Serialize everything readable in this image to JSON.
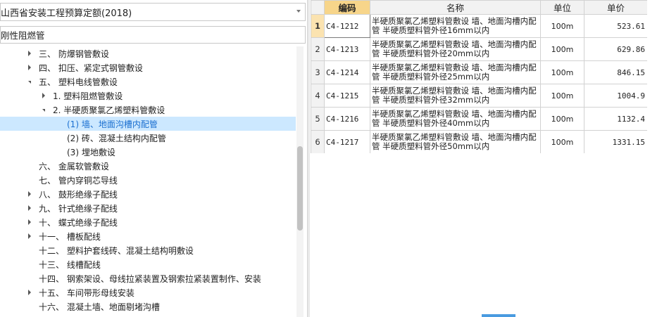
{
  "left": {
    "quota_select": "山西省安装工程预算定额(2018)",
    "search_value": "刚性阻燃管",
    "tree": [
      {
        "label": "三、 防爆钢管敷设",
        "level": 1,
        "state": "collapsed"
      },
      {
        "label": "四、 扣压、紧定式钢管敷设",
        "level": 1,
        "state": "collapsed"
      },
      {
        "label": "五、 塑料电线管敷设",
        "level": 1,
        "state": "expanded"
      },
      {
        "label": "1. 塑料阻燃管敷设",
        "level": 2,
        "state": "collapsed"
      },
      {
        "label": "2. 半硬质聚氯乙烯塑料管敷设",
        "level": 2,
        "state": "expanded"
      },
      {
        "label": "(1) 墙、地面沟槽内配管",
        "level": 3,
        "state": "leaf",
        "selected": true
      },
      {
        "label": "(2) 砖、混凝土结构内配管",
        "level": 3,
        "state": "leaf"
      },
      {
        "label": "(3) 埋地敷设",
        "level": 3,
        "state": "leaf"
      },
      {
        "label": "六、 金属软管敷设",
        "level": 1,
        "state": "leaf"
      },
      {
        "label": "七、 管内穿铜芯导线",
        "level": 1,
        "state": "leaf"
      },
      {
        "label": "八、 鼓形绝缘子配线",
        "level": 1,
        "state": "collapsed"
      },
      {
        "label": "九、 针式绝缘子配线",
        "level": 1,
        "state": "collapsed"
      },
      {
        "label": "十、 蝶式绝缘子配线",
        "level": 1,
        "state": "collapsed"
      },
      {
        "label": "十一、 槽板配线",
        "level": 1,
        "state": "collapsed"
      },
      {
        "label": "十二、 塑料护套线砖、混凝土结构明敷设",
        "level": 1,
        "state": "leaf"
      },
      {
        "label": "十三、 线槽配线",
        "level": 1,
        "state": "leaf"
      },
      {
        "label": "十四、 钢索架设、母线拉紧装置及钢索拉紧装置制作、安装",
        "level": 1,
        "state": "leaf"
      },
      {
        "label": "十五、 车间带形母线安装",
        "level": 1,
        "state": "collapsed"
      },
      {
        "label": "十六、 混凝土墙、地面剔堵沟槽",
        "level": 1,
        "state": "leaf"
      }
    ]
  },
  "grid": {
    "headers": {
      "code": "编码",
      "name": "名称",
      "unit": "单位",
      "price": "单价"
    },
    "rows": [
      {
        "num": "1",
        "code": "C4-1212",
        "name": "半硬质聚氯乙烯塑料管敷设 墙、地面沟槽内配管 半硬质塑料管外径16mm以内",
        "unit": "100m",
        "price": "523.61"
      },
      {
        "num": "2",
        "code": "C4-1213",
        "name": "半硬质聚氯乙烯塑料管敷设 墙、地面沟槽内配管 半硬质塑料管外径20mm以内",
        "unit": "100m",
        "price": "629.86"
      },
      {
        "num": "3",
        "code": "C4-1214",
        "name": "半硬质聚氯乙烯塑料管敷设 墙、地面沟槽内配管 半硬质塑料管外径25mm以内",
        "unit": "100m",
        "price": "846.15"
      },
      {
        "num": "4",
        "code": "C4-1215",
        "name": "半硬质聚氯乙烯塑料管敷设 墙、地面沟槽内配管 半硬质塑料管外径32mm以内",
        "unit": "100m",
        "price": "1004.9"
      },
      {
        "num": "5",
        "code": "C4-1216",
        "name": "半硬质聚氯乙烯塑料管敷设 墙、地面沟槽内配管 半硬质塑料管外径40mm以内",
        "unit": "100m",
        "price": "1132.4"
      },
      {
        "num": "6",
        "code": "C4-1217",
        "name": "半硬质聚氯乙烯塑料管敷设 墙、地面沟槽内配管 半硬质塑料管外径50mm以内",
        "unit": "100m",
        "price": "1331.15"
      }
    ]
  },
  "colors": {
    "selected_bg": "#cce8ff",
    "selected_text": "#1a6fd0",
    "header_active": "#f7d58a"
  }
}
